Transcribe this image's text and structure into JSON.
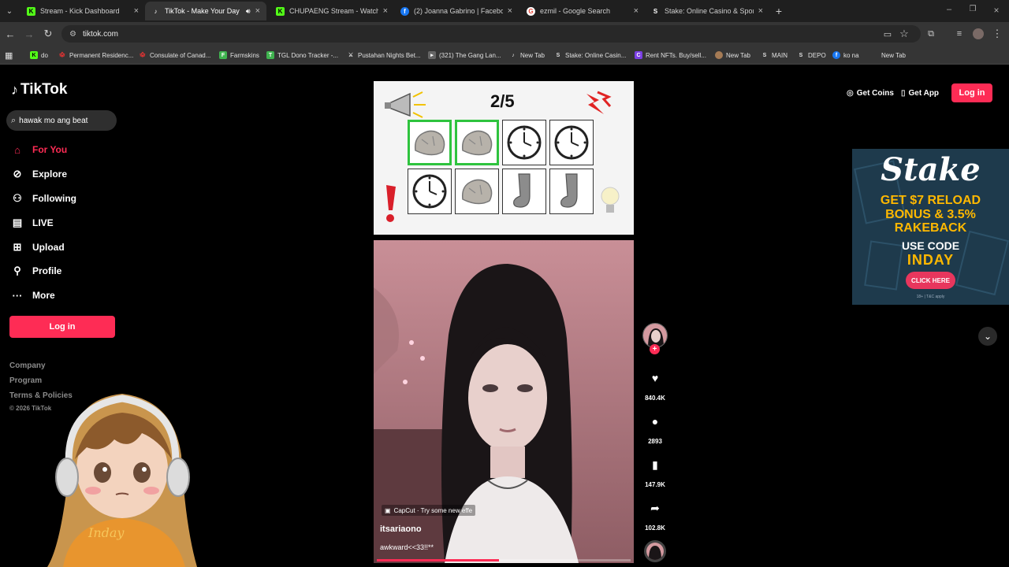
{
  "browser": {
    "tabs": [
      {
        "icon": "kick-icon",
        "title": "Stream - Kick Dashboard"
      },
      {
        "icon": "tiktok-icon",
        "title": "TikTok - Make Your Day",
        "active": true
      },
      {
        "icon": "kick-icon",
        "title": "CHUPAENG Stream - Watch Li"
      },
      {
        "icon": "facebook-icon",
        "title": "(2) Joanna Gabrino | Facebook"
      },
      {
        "icon": "google-icon",
        "title": "ezmil - Google Search"
      },
      {
        "icon": "stake-icon",
        "title": "Stake: Online Casino & Sports"
      }
    ],
    "url": "tiktok.com",
    "bookmarks": [
      {
        "icon": "kick-icon",
        "label": "do"
      },
      {
        "icon": "maple-leaf-icon",
        "label": "Permanent Residenc..."
      },
      {
        "icon": "maple-leaf-icon",
        "label": "Consulate of Canad..."
      },
      {
        "icon": "farmskins-icon",
        "label": "Farmskins"
      },
      {
        "icon": "tgl-icon",
        "label": "TGL Dono Tracker -..."
      },
      {
        "icon": "pustahan-icon",
        "label": "Pustahan Nights Bet..."
      },
      {
        "icon": "youtube-icon",
        "label": "(321) The Gang Lan..."
      },
      {
        "icon": "tiktok-icon",
        "label": "New Tab"
      },
      {
        "icon": "stake-icon",
        "label": "Stake: Online Casin..."
      },
      {
        "icon": "nft-icon",
        "label": "Rent NFTs. Buy/sell..."
      },
      {
        "icon": "avatar-icon",
        "label": "New Tab"
      },
      {
        "icon": "stake-icon",
        "label": "MAIN"
      },
      {
        "icon": "stake-icon",
        "label": "DEPO"
      },
      {
        "icon": "facebook-icon",
        "label": "ko na"
      },
      {
        "icon": "blank-icon",
        "label": "New Tab"
      }
    ]
  },
  "tiktok": {
    "logo": "TikTok",
    "search_value": "hawak mo ang beat",
    "nav": [
      {
        "icon": "home-icon",
        "label": "For You",
        "active": true
      },
      {
        "icon": "compass-icon",
        "label": "Explore"
      },
      {
        "icon": "following-icon",
        "label": "Following"
      },
      {
        "icon": "live-icon",
        "label": "LIVE"
      },
      {
        "icon": "upload-icon",
        "label": "Upload"
      },
      {
        "icon": "profile-icon",
        "label": "Profile"
      },
      {
        "icon": "more-icon",
        "label": "More"
      }
    ],
    "login_label": "Log in",
    "footer": [
      "Company",
      "Program",
      "Terms & Policies",
      "© 2026 TikTok"
    ],
    "top_links": {
      "coins": "Get Coins",
      "app": "Get App",
      "login": "Log in"
    }
  },
  "overlay": {
    "avatar_name": "Inday",
    "game": {
      "counter": "2/5",
      "row1": [
        {
          "item": "rock",
          "selected": true
        },
        {
          "item": "rock",
          "selected": true
        },
        {
          "item": "clock",
          "selected": false
        },
        {
          "item": "clock",
          "selected": false
        }
      ],
      "row2": [
        {
          "item": "clock",
          "selected": false
        },
        {
          "item": "rock",
          "selected": false
        },
        {
          "item": "sock",
          "selected": false
        },
        {
          "item": "sock",
          "selected": false
        }
      ]
    }
  },
  "video": {
    "capcut_label": "CapCut · Try some new effe",
    "username": "itsariaono",
    "caption": "awkward<<33!!**",
    "progress": 0.48,
    "likes": "840.4K",
    "comments": "2893",
    "saves": "147.9K",
    "shares": "102.8K"
  },
  "ad": {
    "brand": "Stake",
    "line1": "GET $7 RELOAD",
    "line2": "BONUS & 3.5%",
    "line3": "RAKEBACK",
    "use_code": "USE CODE",
    "code": "INDAY",
    "cta": "CLICK HERE",
    "fine_print": "18+ | T&C apply",
    "accent": "#ffb800",
    "bg": "#1e3a4c"
  },
  "colors": {
    "brand_pink": "#fe2c55",
    "selected_green": "#2ec33e"
  }
}
